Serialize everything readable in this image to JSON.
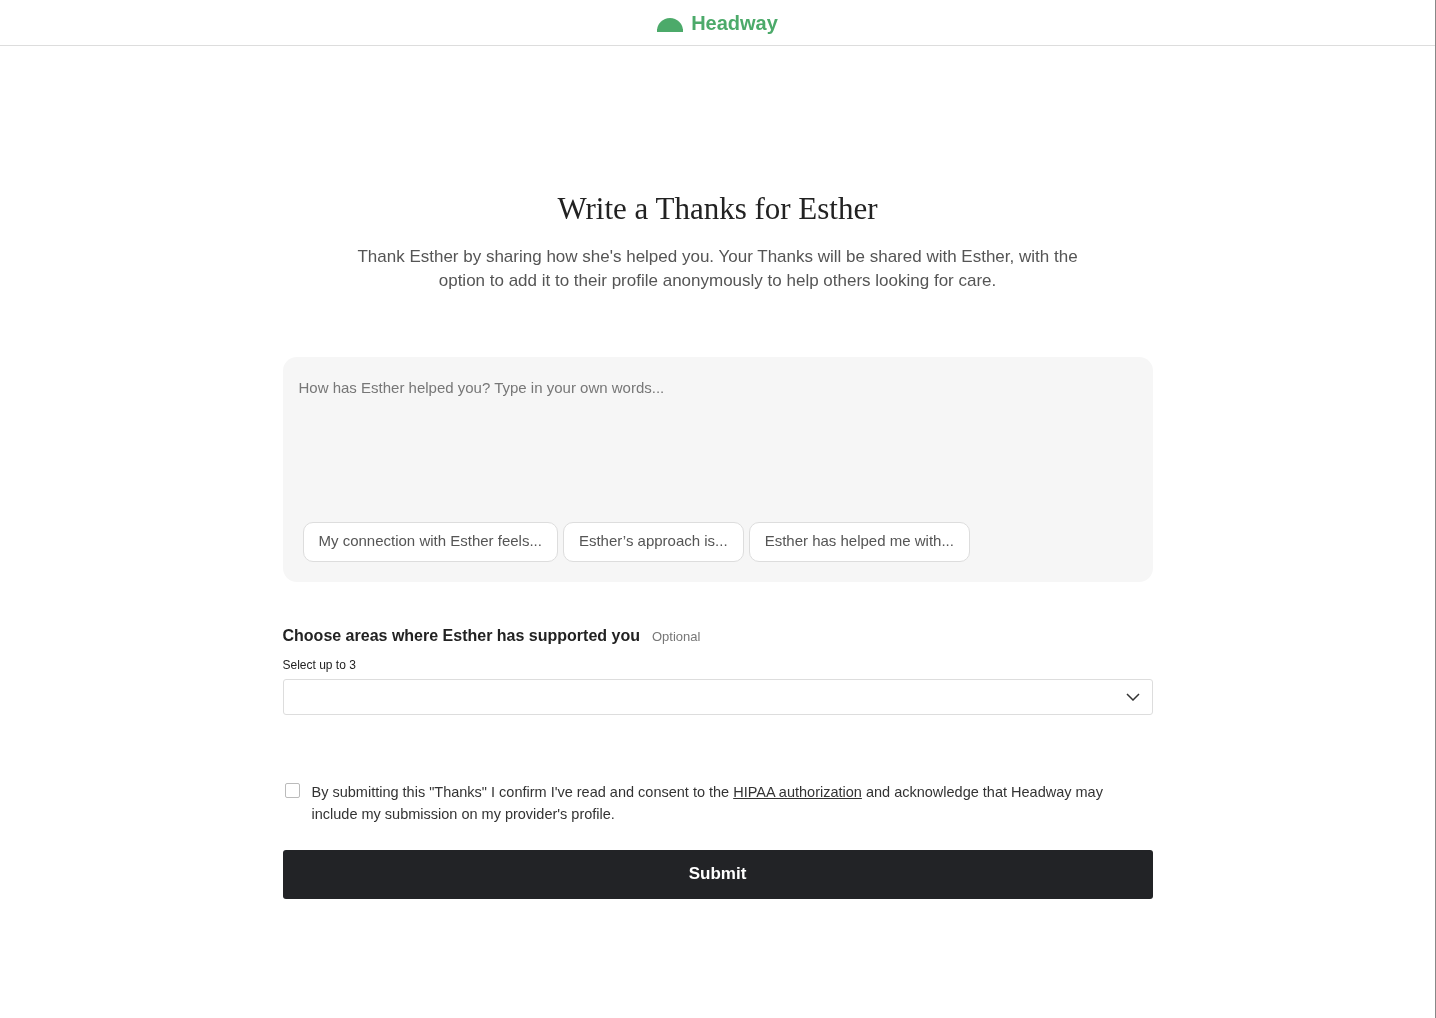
{
  "header": {
    "logo_text": "Headway"
  },
  "title": "Write a Thanks for Esther",
  "subtitle": "Thank Esther by sharing how she's helped you. Your Thanks will be shared with Esther, with the option to add it to their profile anonymously to help others looking for care.",
  "message": {
    "placeholder": "How has Esther helped you? Type in your own words...",
    "prompts": [
      "My connection with Esther feels...",
      "Esther’s approach is...",
      "Esther has helped me with..."
    ]
  },
  "areas": {
    "label": "Choose areas where Esther has supported you",
    "optional": "Optional",
    "hint": "Select up to 3"
  },
  "consent": {
    "checked": false,
    "before": "By submitting this \"Thanks\" I confirm I've read and consent to the",
    "link": "HIPAA authorization",
    "after": "and acknowledge that Headway may include my submission on my provider's profile."
  },
  "submit": "Submit"
}
